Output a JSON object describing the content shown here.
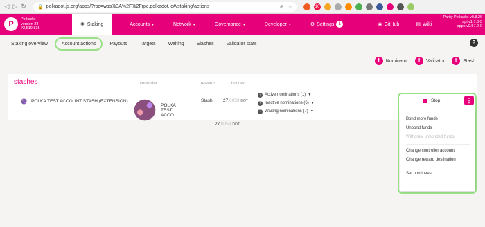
{
  "browser": {
    "url": "polkadot.js.org/apps/?rpc=wss%3A%2F%2Frpc.polkadot.io#/staking/actions",
    "nav_back": "◁",
    "nav_forward": "▷",
    "nav_reload": "↻",
    "ext_badge": "10"
  },
  "app": {
    "chain_name": "Polkadot",
    "chain_version": "version 28",
    "chain_block": "#2,519,835",
    "active_tab": "Staking",
    "menu": [
      "Accounts",
      "Network",
      "Governance",
      "Developer"
    ],
    "settings": "Settings",
    "settings_badge": "1",
    "github": "GitHub",
    "wiki": "Wiki",
    "version_lines": [
      "Parity Polkadot v0.8.26",
      "api v1.7.3-5",
      "apps v0.57.2-0"
    ],
    "colors": {
      "brand": "#e6007a",
      "highlight": "#9be18a"
    }
  },
  "subnav": {
    "tabs": [
      "Staking overview",
      "Account actions",
      "Payouts",
      "Targets",
      "Waiting",
      "Slashes",
      "Validator stats"
    ],
    "active": "Account actions"
  },
  "actions": [
    "Nominator",
    "Validator",
    "Stash"
  ],
  "stashes": {
    "title": "stashes",
    "headers": {
      "controller": "controller",
      "rewards": "rewards",
      "bonded": "bonded"
    },
    "row": {
      "stash": "POLKA TEST ACCOUNT STASH (EXTENSION)",
      "controller": "POLKA TEST ACCO...",
      "rewards": "Stash",
      "bonded_main": "27.",
      "bonded_faint": "0059",
      "bonded_unit": "DOT",
      "nominations": [
        "Active nominations (1)",
        "Inactive nominations (6)",
        "Waiting nominations (7)"
      ]
    },
    "total": {
      "main": "27.",
      "faint": "0059",
      "unit": "DOT"
    }
  },
  "stop_label": "Stop",
  "popup": {
    "group1": [
      "Bond more funds",
      "Unbond funds"
    ],
    "disabled": "Withdraw unbonded funds",
    "group2": [
      "Change controller account",
      "Change reward destination"
    ],
    "group3": [
      "Set nominees"
    ]
  }
}
